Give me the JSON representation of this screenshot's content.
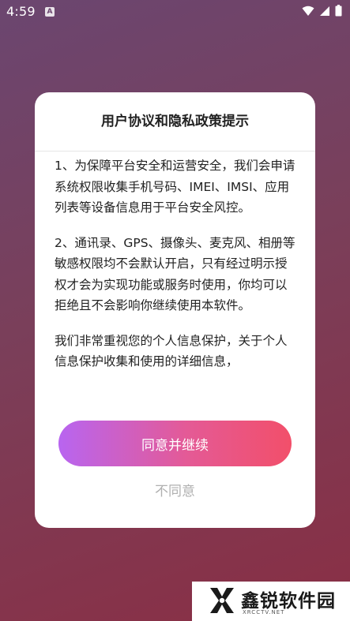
{
  "status_bar": {
    "time": "4:59",
    "app_icon_glyph": "A",
    "icons": [
      "wifi-icon",
      "cellular-icon",
      "battery-icon"
    ]
  },
  "dialog": {
    "title": "用户协议和隐私政策提示",
    "paragraphs": [
      "1、为保障平台安全和运营安全，我们会申请系统权限收集手机号码、IMEI、IMSI、应用列表等设备信息用于平台安全风控。",
      "2、通讯录、GPS、摄像头、麦克风、相册等敏感权限均不会默认开启，只有经过明示授权才会为实现功能或服务时使用，你均可以拒绝且不会影响你继续使用本软件。",
      "我们非常重视您的个人信息保护，关于个人信息保护收集和使用的详细信息，"
    ],
    "agree_label": "同意并继续",
    "disagree_label": "不同意"
  },
  "watermark": {
    "name": "鑫锐软件园",
    "url": "XRCCTV.NET"
  },
  "colors": {
    "agree_gradient_start": "#b865f0",
    "agree_gradient_end": "#f24f6a",
    "disagree_text": "#b0b0b0"
  }
}
